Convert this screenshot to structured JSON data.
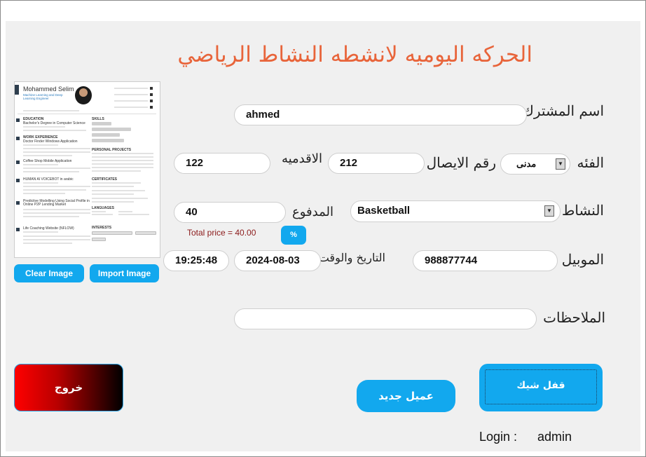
{
  "title": "الحركه اليوميه لانشطه النشاط الرياضي",
  "labels": {
    "subscriber_name": "اسم المشترك",
    "category": "الفئه",
    "receipt_number": "رقم الايصال",
    "academy": "الاقدميه",
    "activity": "النشاط",
    "paid": "المدفوع",
    "mobile": "الموبيل",
    "date_time": "التاريخ والوقت",
    "notes": "الملاحظات"
  },
  "fields": {
    "subscriber_name": "ahmed",
    "category": "مدنى",
    "receipt_number": "212",
    "academy": "122",
    "activity": "Basketball",
    "paid": "40",
    "mobile": "988877744",
    "date": "2024-08-03",
    "time": "19:25:48",
    "notes": ""
  },
  "total_price": "Total price = 40.00",
  "percent_button": "%",
  "buttons": {
    "clear_image": "Clear Image",
    "import_image": "Import Image",
    "exit": "خروج",
    "new_client": "عميل جديد",
    "close_check": "قفل شيك"
  },
  "login": {
    "label": "Login :",
    "user": "admin"
  },
  "resume": {
    "name": "Mohammed Selim",
    "subtitle": "Machine Learning and Deep Learning Engineer",
    "sections": [
      "EDUCATION",
      "WORK EXPERIENCE",
      "SKILLS",
      "PERSONAL PROJECTS",
      "CERTIFICATES",
      "LANGUAGES",
      "INTERESTS"
    ],
    "items": [
      "Bachelor's Degree in Computer Science",
      "Doctor Finder Windows Application",
      "Coffee Shop Mobile Application",
      "HUMAN AI VOICEBOT in arabic",
      "Predictive Modelling Using Social Profile in Online P2P Lending Market",
      "Life Coaching Website (NFLOW)"
    ]
  },
  "colors": {
    "accent": "#12a8ee",
    "title": "#e8643a",
    "total": "#8b1a1a",
    "exit_start": "#ff0000",
    "exit_end": "#000000"
  }
}
